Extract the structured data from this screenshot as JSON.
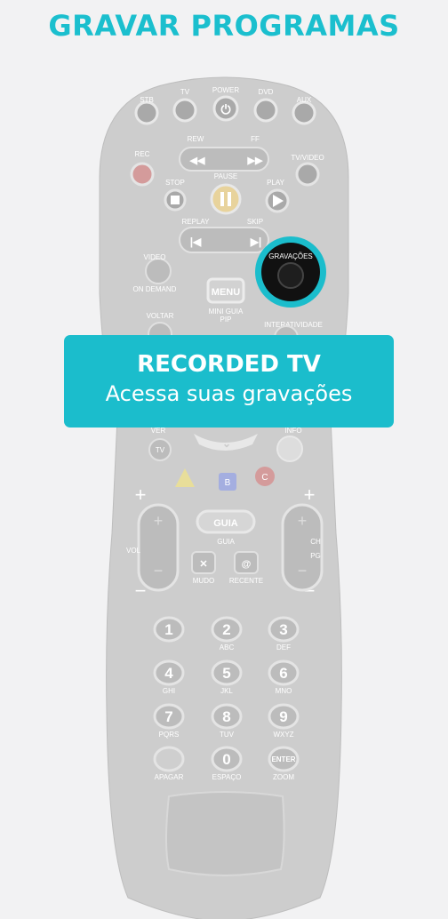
{
  "page": {
    "title": "GRAVAR PROGRAMAS"
  },
  "callout": {
    "heading": "RECORDED TV",
    "subtitle": "Acessa suas gravações"
  },
  "highlight": {
    "label": "GRAVAÇÕES"
  },
  "remote": {
    "source_buttons": {
      "stb": "STB",
      "tv": "TV",
      "power": "POWER",
      "dvd": "DVD",
      "aux": "AUX"
    },
    "labels": {
      "rec": "REC",
      "tvvideo": "TV/VIDEO",
      "rew": "REW",
      "ff": "FF",
      "stop": "STOP",
      "pause": "PAUSE",
      "play": "PLAY",
      "replay": "REPLAY",
      "skip": "SKIP",
      "video": "VIDEO",
      "on_demand": "ON DEMAND",
      "menu": "MENU",
      "mini_guia": "MINI GUIA",
      "pip": "PIP",
      "voltar": "VOLTAR",
      "interatividade": "INTERATIVIDADE",
      "ver": "VER",
      "tv": "TV",
      "info": "INFO",
      "b": "B",
      "c": "C",
      "guia_button": "GUIA",
      "guia": "GUIA",
      "vol": "VOL",
      "ch": "CH",
      "pg": "PG",
      "mudo": "MUDO",
      "recente": "RECENTE",
      "plus": "+",
      "minus": "−"
    },
    "keypad": [
      {
        "num": "1",
        "letters": ""
      },
      {
        "num": "2",
        "letters": "ABC"
      },
      {
        "num": "3",
        "letters": "DEF"
      },
      {
        "num": "4",
        "letters": "GHI"
      },
      {
        "num": "5",
        "letters": "JKL"
      },
      {
        "num": "6",
        "letters": "MNO"
      },
      {
        "num": "7",
        "letters": "PQRS"
      },
      {
        "num": "8",
        "letters": "TUV"
      },
      {
        "num": "9",
        "letters": "WXYZ"
      },
      {
        "num": "",
        "letters": "APAGAR"
      },
      {
        "num": "0",
        "letters": "ESPAÇO"
      },
      {
        "num": "ENTER",
        "letters": "ZOOM"
      }
    ]
  }
}
